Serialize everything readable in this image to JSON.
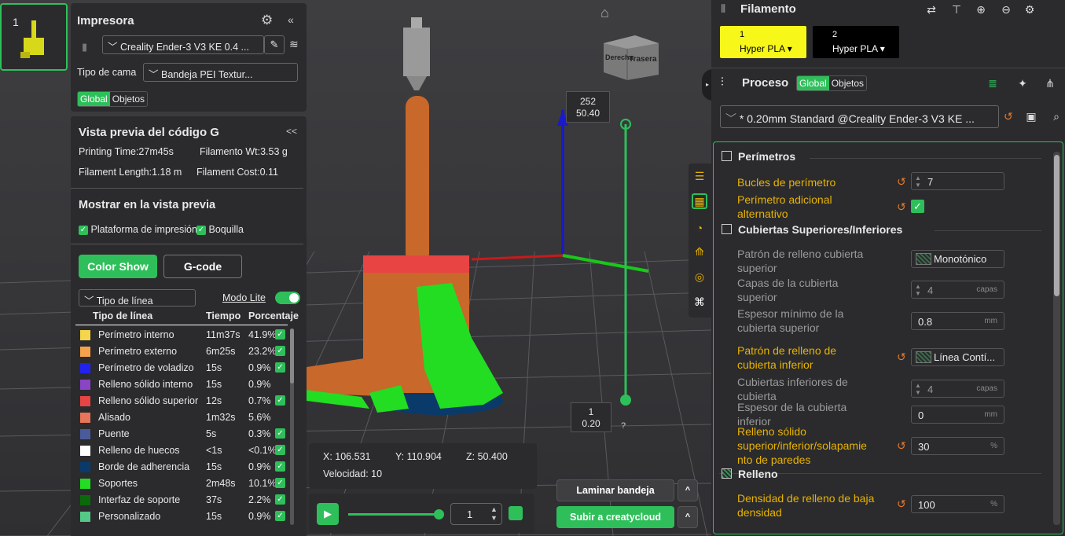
{
  "plate": {
    "number": "1"
  },
  "printer": {
    "title": "Impresora",
    "selected": "Creality Ender-3 V3 KE 0.4 ...",
    "bed_label": "Tipo de cama",
    "bed_value": "Bandeja PEI Textur...",
    "tab_global": "Global",
    "tab_objects": "Objetos",
    "collapse": "«"
  },
  "gcode": {
    "title": "Vista previa del código G",
    "collapse": "<<",
    "printing_time": "Printing Time:27m45s",
    "filament_wt": "Filamento Wt:3.53 g",
    "filament_length": "Filament Length:1.18 m",
    "filament_cost": "Filament Cost:0.11"
  },
  "show": {
    "title": "Mostrar en la vista previa",
    "platform": "Plataforma de impresión",
    "nozzle": "Boquilla"
  },
  "buttons": {
    "color_show": "Color Show",
    "gcode": "G-code"
  },
  "line_type": {
    "dropdown": "Tipo de línea",
    "lite_mode": "Modo Lite"
  },
  "legend": {
    "headers": [
      "Tipo de línea",
      "Tiempo",
      "Porcentaje"
    ],
    "rows": [
      {
        "name": "Perímetro interno",
        "time": "11m37s",
        "pct": "41.9%",
        "color": "#f5d54a",
        "checked": true
      },
      {
        "name": "Perímetro externo",
        "time": "6m25s",
        "pct": "23.2%",
        "color": "#f5a24a",
        "checked": true
      },
      {
        "name": "Perímetro de voladizo",
        "time": "15s",
        "pct": "0.9%",
        "color": "#2222ee",
        "checked": true
      },
      {
        "name": "Relleno sólido interno",
        "time": "15s",
        "pct": "0.9%",
        "color": "#8a44c8",
        "checked": false
      },
      {
        "name": "Relleno sólido superior",
        "time": "12s",
        "pct": "0.7%",
        "color": "#e84444",
        "checked": true
      },
      {
        "name": "Alisado",
        "time": "1m32s",
        "pct": "5.6%",
        "color": "#e8745a",
        "checked": false
      },
      {
        "name": "Puente",
        "time": "5s",
        "pct": "0.3%",
        "color": "#4a5a9a",
        "checked": true
      },
      {
        "name": "Relleno de huecos",
        "time": "<1s",
        "pct": "<0.1%",
        "color": "#ffffff",
        "checked": true
      },
      {
        "name": "Borde de adherencia",
        "time": "15s",
        "pct": "0.9%",
        "color": "#0a3a6a",
        "checked": true
      },
      {
        "name": "Soportes",
        "time": "2m48s",
        "pct": "10.1%",
        "color": "#22dd22",
        "checked": true
      },
      {
        "name": "Interfaz de soporte",
        "time": "37s",
        "pct": "2.2%",
        "color": "#0a6a0a",
        "checked": true
      },
      {
        "name": "Personalizado",
        "time": "15s",
        "pct": "0.9%",
        "color": "#55c888",
        "checked": true
      }
    ]
  },
  "viewport": {
    "top_label_a": "252",
    "top_label_b": "50.40",
    "bottom_label_a": "1",
    "bottom_label_b": "0.20",
    "help": "?",
    "cube_right": "Derecha",
    "cube_back": "Trasera"
  },
  "coords": {
    "x": "X: 106.531",
    "y": "Y: 110.904",
    "z": "Z: 50.400",
    "speed": "Velocidad: 10"
  },
  "player": {
    "layer": "1",
    "progress": 1.0
  },
  "actions": {
    "slice": "Laminar bandeja",
    "upload": "Subir a creatycloud"
  },
  "filament": {
    "title": "Filamento",
    "slots": [
      {
        "num": "1",
        "name": "Hyper PLA",
        "color": "#f7f71a",
        "text_color": "#000000"
      },
      {
        "num": "2",
        "name": "Hyper PLA",
        "color": "#000000",
        "text_color": "#ffffff"
      }
    ]
  },
  "process": {
    "title": "Proceso",
    "tab_global": "Global",
    "tab_objects": "Objetos",
    "profile": "* 0.20mm Standard @Creality Ender-3 V3 KE ..."
  },
  "settings": {
    "perimeters": {
      "title": "Perímetros",
      "loops_label": "Bucles de perímetro",
      "loops_value": "7",
      "alt_label_1": "Perímetro adicional",
      "alt_label_2": "alternativo"
    },
    "shells": {
      "title": "Cubiertas Superiores/Inferiores",
      "top_pattern_1": "Patrón de relleno cubierta",
      "top_pattern_2": "superior",
      "top_pattern_value": "Monotónico",
      "top_layers_1": "Capas de la cubierta",
      "top_layers_2": "superior",
      "top_layers_value": "4",
      "top_layers_unit": "capas",
      "top_thick_1": "Espesor mínimo de la",
      "top_thick_2": "cubierta superior",
      "top_thick_value": "0.8",
      "top_thick_unit": "mm",
      "bottom_pattern_1": "Patrón de relleno de",
      "bottom_pattern_2": "cubierta inferior",
      "bottom_pattern_value": "Línea Contí...",
      "bottom_layers_1": "Cubiertas inferiores de",
      "bottom_layers_2": "cubierta",
      "bottom_layers_value": "4",
      "bottom_layers_unit": "capas",
      "bottom_thick_1": "Espesor de la cubierta",
      "bottom_thick_2": "inferior",
      "bottom_thick_value": "0",
      "bottom_thick_unit": "mm",
      "overlap_1": "Relleno sólido",
      "overlap_2": "superior/inferior/solapamie",
      "overlap_3": "nto de paredes",
      "overlap_value": "30",
      "overlap_unit": "%"
    },
    "infill": {
      "title": "Relleno",
      "density_1": "Densidad de relleno de baja",
      "density_2": "densidad",
      "density_value": "100",
      "density_unit": "%"
    }
  }
}
